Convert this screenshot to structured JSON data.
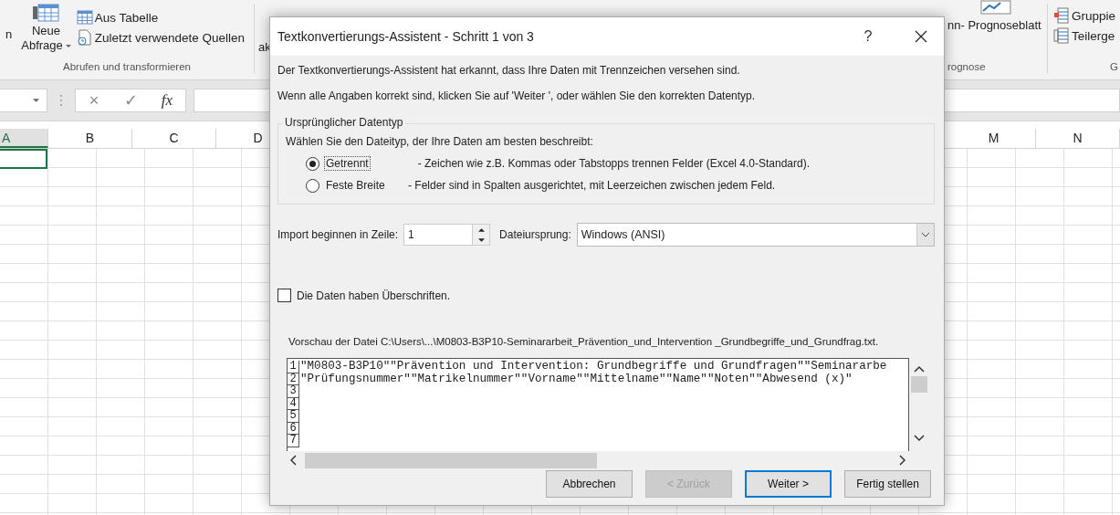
{
  "ribbon": {
    "left_group": {
      "cut_label": "n",
      "new_query": {
        "label_1": "Neue",
        "label_2": "Abfrage"
      },
      "items": [
        "Aus Tabelle",
        "Zuletzt verwendete Quellen"
      ],
      "group_label": "Abrufen und transformieren"
    },
    "cut_text": "ak",
    "forecast_group": {
      "button": "nn- Prognoseblatt",
      "group_label": "rognose"
    },
    "outline_group": {
      "items": [
        "Gruppie",
        "Teilerge"
      ],
      "group_label": "G"
    }
  },
  "formula_bar": {
    "cancel": "×",
    "enter": "✓",
    "function": "fx"
  },
  "columns": [
    {
      "label": "A",
      "selected": true
    },
    {
      "label": "B",
      "selected": false
    },
    {
      "label": "C",
      "selected": false
    },
    {
      "label": "D",
      "selected": false
    },
    {
      "label": "M",
      "selected": false
    },
    {
      "label": "N",
      "selected": false
    }
  ],
  "dialog": {
    "title": "Textkonvertierungs-Assistent - Schritt 1 von 3",
    "help": "?",
    "intro": [
      "Der Textkonvertierungs-Assistent hat erkannt, dass Ihre Daten mit Trennzeichen versehen sind.",
      "Wenn alle Angaben korrekt sind, klicken Sie auf 'Weiter ', oder wählen Sie den korrekten Datentyp."
    ],
    "group": {
      "title": "Ursprünglicher Datentyp",
      "prompt": "Wählen Sie den Dateityp, der Ihre Daten am besten beschreibt:",
      "options": [
        {
          "label": "Getrennt",
          "description": "- Zeichen wie z.B. Kommas oder Tabstopps trennen Felder (Excel 4.0-Standard).",
          "selected": true
        },
        {
          "label": "Feste Breite",
          "description": "- Felder sind in Spalten ausgerichtet, mit Leerzeichen zwischen jedem Feld.",
          "selected": false
        }
      ]
    },
    "start_row": {
      "label": "Import beginnen in Zeile:",
      "value": "1"
    },
    "origin": {
      "label": "Dateiursprung:",
      "value": "Windows (ANSI)"
    },
    "headers_checkbox": {
      "label": "Die Daten haben Überschriften.",
      "checked": false
    },
    "preview_label": "Vorschau der Datei C:\\Users\\...\\M0803-B3P10-Seminararbeit_Prävention_und_Intervention _Grundbegriffe_und_Grundfrag.txt.",
    "preview_lines": [
      {
        "number": "1",
        "text": "\"M0803-B3P10\"\"Prävention und Intervention: Grundbegriffe und Grundfragen\"\"Seminararbe"
      },
      {
        "number": "2",
        "text": "\"Prüfungsnummer\"\"Matrikelnummer\"\"Vorname\"\"Mittelname\"\"Name\"\"Noten\"\"Abwesend (x)\""
      },
      {
        "number": "3"
      },
      {
        "number": "4"
      },
      {
        "number": "5"
      },
      {
        "number": "6"
      },
      {
        "number": "7"
      }
    ],
    "buttons": [
      {
        "label": "Abbrechen",
        "disabled": false,
        "default": false
      },
      {
        "label": "< Zurück",
        "disabled": true,
        "default": false
      },
      {
        "label": "Weiter >",
        "disabled": false,
        "default": true
      },
      {
        "label": "Fertig stellen",
        "disabled": false,
        "default": false
      }
    ]
  }
}
